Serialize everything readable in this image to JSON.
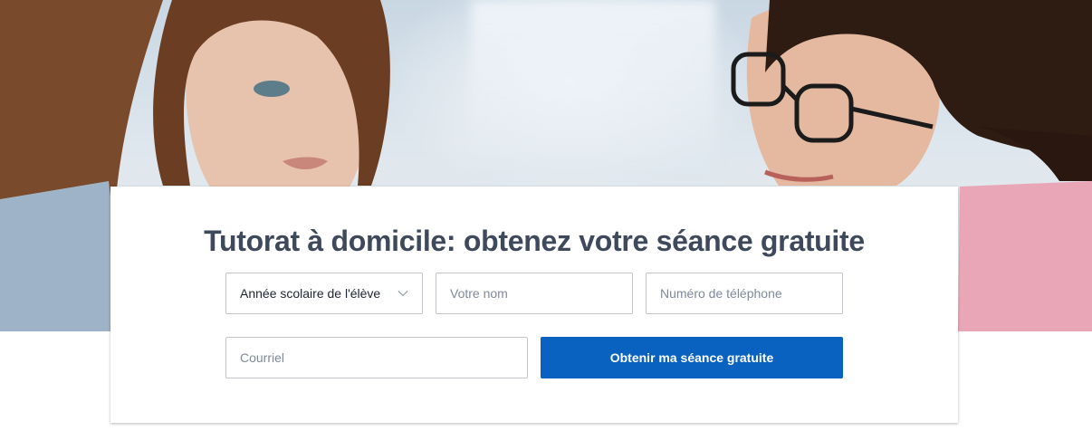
{
  "form": {
    "title": "Tutorat à domicile: obtenez votre séance gratuite",
    "grade_select": {
      "selected": "Année scolaire de l'élève",
      "icon": "chevron-down-icon"
    },
    "name_input": {
      "placeholder": "Votre nom",
      "value": ""
    },
    "phone_input": {
      "placeholder": "Numéro de téléphone",
      "value": ""
    },
    "email_input": {
      "placeholder": "Courriel",
      "value": ""
    },
    "submit_label": "Obtenir ma séance gratuite"
  },
  "colors": {
    "button": "#0a62c0",
    "title": "#3e4a5c",
    "border": "#c4c7cc"
  }
}
